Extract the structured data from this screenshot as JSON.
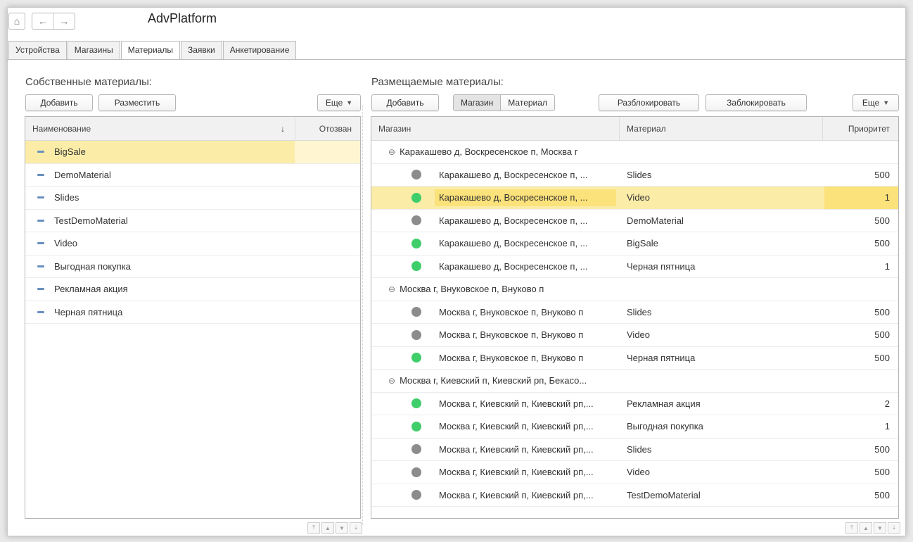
{
  "app": {
    "title": "AdvPlatform"
  },
  "nav": {
    "home": "⌂",
    "back": "←",
    "forward": "→"
  },
  "tabs": [
    "Устройства",
    "Магазины",
    "Материалы",
    "Заявки",
    "Анкетирование"
  ],
  "left": {
    "title": "Собственные материалы:",
    "buttons": {
      "add": "Добавить",
      "place": "Разместить",
      "more": "Еще"
    },
    "columns": {
      "name": "Наименование",
      "sort": "↓",
      "revoked": "Отозван"
    },
    "rows": [
      "BigSale",
      "DemoMaterial",
      "Slides",
      "TestDemoMaterial",
      "Video",
      "Выгодная покупка",
      "Рекламная акция",
      "Черная пятница"
    ]
  },
  "right": {
    "title": "Размещаемые  материалы:",
    "buttons": {
      "add": "Добавить",
      "shop": "Магазин",
      "material": "Материал",
      "unblock": "Разблокировать",
      "block": "Заблокировать",
      "more": "Еще"
    },
    "columns": {
      "shop": "Магазин",
      "material": "Материал",
      "priority": "Приоритет"
    },
    "group_sign": "⊖",
    "groups": [
      {
        "name": "Каракашево д, Воскресенское п, Москва г",
        "rows": [
          {
            "shop": "Каракашево д, Воскресенское п, ...",
            "material": "Slides",
            "priority": "500",
            "status": "gray"
          },
          {
            "shop": "Каракашево д, Воскресенское п, ...",
            "material": "Video",
            "priority": "1",
            "status": "green",
            "selected": true
          },
          {
            "shop": "Каракашево д, Воскресенское п, ...",
            "material": "DemoMaterial",
            "priority": "500",
            "status": "gray"
          },
          {
            "shop": "Каракашево д, Воскресенское п, ...",
            "material": "BigSale",
            "priority": "500",
            "status": "green"
          },
          {
            "shop": "Каракашево д, Воскресенское п, ...",
            "material": "Черная пятница",
            "priority": "1",
            "status": "green"
          }
        ]
      },
      {
        "name": "Москва г, Внуковское п, Внуково п",
        "rows": [
          {
            "shop": "Москва г, Внуковское п, Внуково п",
            "material": "Slides",
            "priority": "500",
            "status": "gray"
          },
          {
            "shop": "Москва г, Внуковское п, Внуково п",
            "material": "Video",
            "priority": "500",
            "status": "gray"
          },
          {
            "shop": "Москва г, Внуковское п, Внуково п",
            "material": "Черная пятница",
            "priority": "500",
            "status": "green"
          }
        ]
      },
      {
        "name": "Москва г, Киевский п, Киевский рп, Бекасо...",
        "rows": [
          {
            "shop": "Москва г, Киевский п, Киевский рп,...",
            "material": "Рекламная акция",
            "priority": "2",
            "status": "green"
          },
          {
            "shop": "Москва г, Киевский п, Киевский рп,...",
            "material": "Выгодная покупка",
            "priority": "1",
            "status": "green"
          },
          {
            "shop": "Москва г, Киевский п, Киевский рп,...",
            "material": "Slides",
            "priority": "500",
            "status": "gray"
          },
          {
            "shop": "Москва г, Киевский п, Киевский рп,...",
            "material": "Video",
            "priority": "500",
            "status": "gray"
          },
          {
            "shop": "Москва г, Киевский п, Киевский рп,...",
            "material": "TestDemoMaterial",
            "priority": "500",
            "status": "gray"
          }
        ]
      }
    ]
  },
  "colors": {
    "green": "#3fce6a",
    "gray": "#8c8c8c",
    "selection": "#fbeda8",
    "selection_cell": "#fbe27a"
  }
}
